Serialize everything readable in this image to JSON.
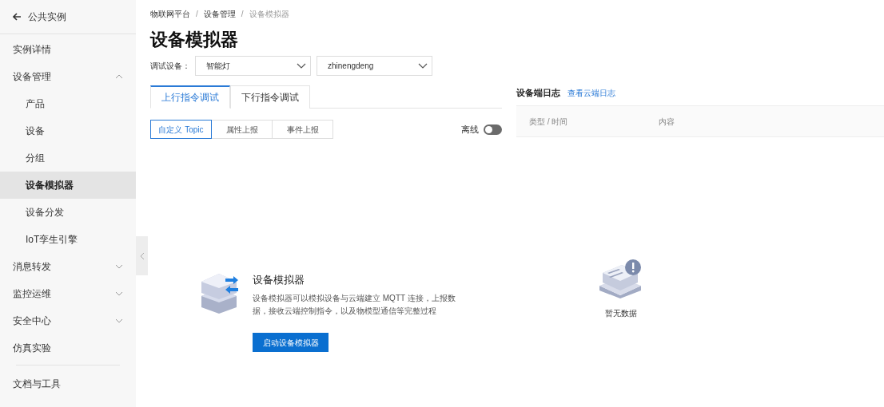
{
  "back": {
    "label": "公共实例"
  },
  "sidebar": {
    "items": [
      {
        "kind": "link",
        "label": "实例详情",
        "selected": false
      },
      {
        "kind": "group",
        "label": "设备管理",
        "selected": false,
        "expanded": true,
        "children": [
          {
            "label": "产品",
            "selected": false
          },
          {
            "label": "设备",
            "selected": false
          },
          {
            "label": "分组",
            "selected": false
          },
          {
            "label": "设备模拟器",
            "selected": true
          },
          {
            "label": "设备分发",
            "selected": false
          },
          {
            "label": "IoT孪生引擎",
            "selected": false
          }
        ]
      },
      {
        "kind": "group",
        "label": "消息转发",
        "selected": false,
        "expanded": false
      },
      {
        "kind": "group",
        "label": "监控运维",
        "selected": false,
        "expanded": false
      },
      {
        "kind": "group",
        "label": "安全中心",
        "selected": false,
        "expanded": false
      },
      {
        "kind": "link",
        "label": "仿真实验",
        "selected": false
      }
    ],
    "footer_items": [
      {
        "label": "文档与工具",
        "selected": false
      }
    ]
  },
  "breadcrumb": [
    {
      "kind": "link",
      "text": "物联网平台"
    },
    {
      "kind": "separator",
      "text": "/"
    },
    {
      "kind": "link",
      "text": "设备管理"
    },
    {
      "kind": "separator",
      "text": "/"
    },
    {
      "kind": "current",
      "text": "设备模拟器"
    }
  ],
  "title": "设备模拟器",
  "device_picker": {
    "label": "调试设备：",
    "selects": [
      {
        "value": "智能灯"
      },
      {
        "value": "zhinengdeng"
      }
    ]
  },
  "tabs": [
    {
      "label": "上行指令调试",
      "selected": true
    },
    {
      "label": "下行指令调试",
      "selected": false
    }
  ],
  "sub_tabs": [
    {
      "label": "自定义 Topic",
      "selected": true
    },
    {
      "label": "属性上报",
      "selected": false
    },
    {
      "label": "事件上报",
      "selected": false
    }
  ],
  "connection": {
    "label": "离线",
    "on": false
  },
  "intro": {
    "title": "设备模拟器",
    "description": "设备模拟器可以模拟设备与云端建立 MQTT 连接，上报数据，接收云端控制指令，以及物模型通信等完整过程",
    "button": "启动设备模拟器"
  },
  "log": {
    "title": "设备端日志",
    "link": "查看云端日志",
    "columns": [
      "类型 / 时间",
      "内容"
    ],
    "empty_text": "暂无数据"
  }
}
